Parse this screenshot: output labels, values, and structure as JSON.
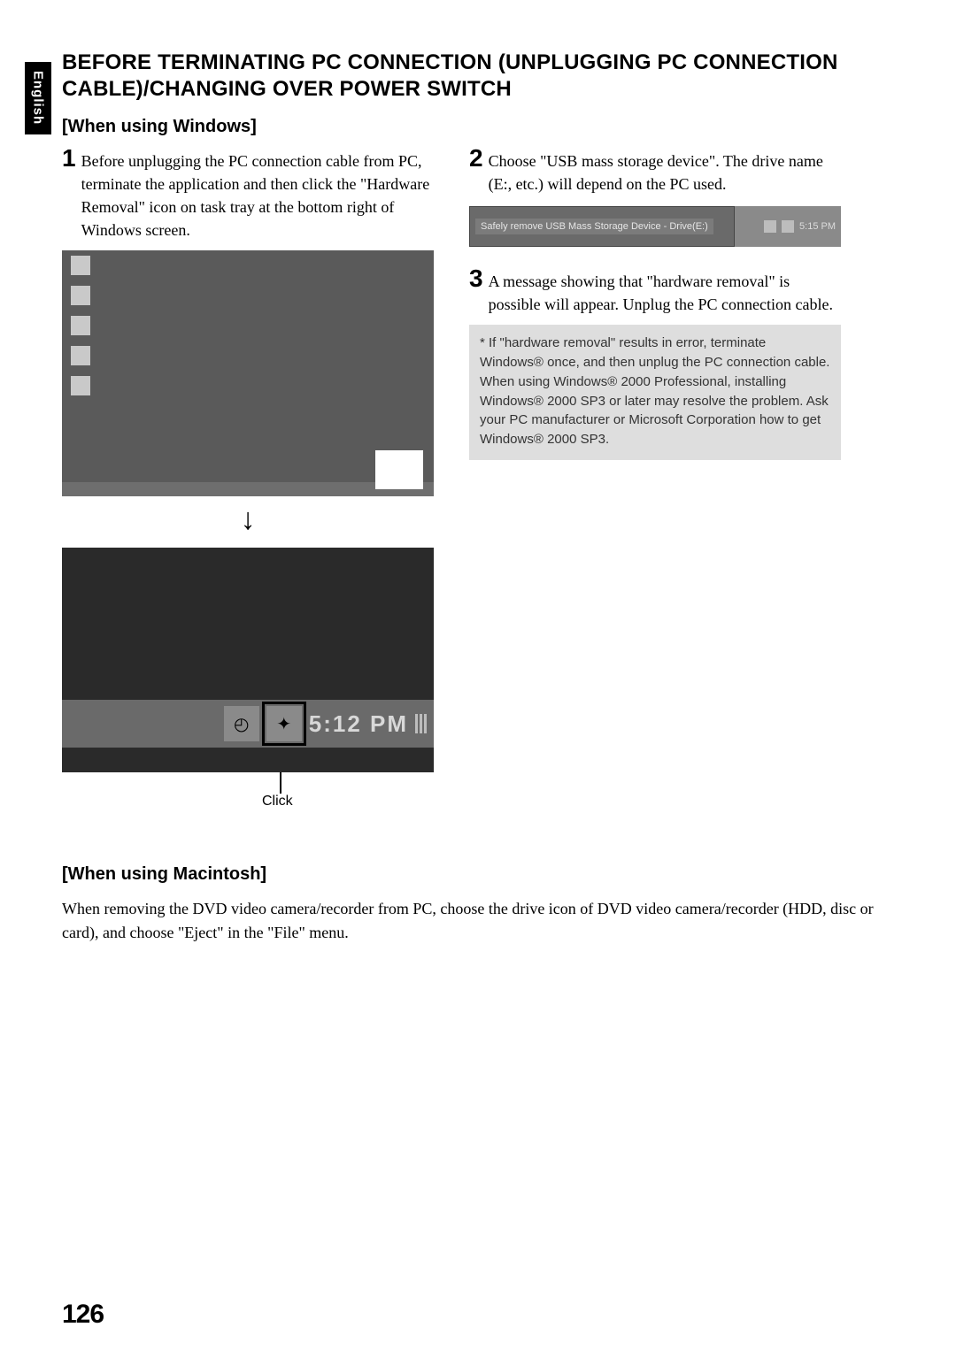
{
  "lang_tab": "English",
  "main_title": "BEFORE TERMINATING PC CONNECTION (UNPLUGGING PC CONNECTION CABLE)/CHANGING OVER POWER SWITCH",
  "windows_section_title": "[When using Windows]",
  "step1": {
    "num": "1",
    "text": "Before unplugging the PC connection cable from PC, terminate the application and then click the \"Hardware Removal\" icon on task tray at the bottom right of Windows screen."
  },
  "step2": {
    "num": "2",
    "text": "Choose \"USB mass storage device\". The drive name (E:, etc.) will depend on the PC used."
  },
  "step3": {
    "num": "3",
    "text": "A message showing that \"hardware removal\" is possible will appear. Unplug the PC connection cable."
  },
  "tooltip_text": "Safely remove USB Mass Storage Device - Drive(E:)",
  "tooltip_time": "5:15 PM",
  "tray_time": "5:12 PM",
  "click_label": "Click",
  "note_text": "* If \"hardware removal\" results in error, terminate Windows® once, and then unplug the PC connection cable. When using Windows® 2000 Professional, installing Windows® 2000 SP3 or later may resolve the problem. Ask your PC manufacturer or Microsoft Corporation how to get Windows® 2000 SP3.",
  "mac_section_title": "[When using Macintosh]",
  "mac_text": "When removing the DVD video camera/recorder from PC, choose the drive icon of DVD video camera/recorder (HDD, disc or card), and choose \"Eject\" in the \"File\" menu.",
  "page_number": "126"
}
